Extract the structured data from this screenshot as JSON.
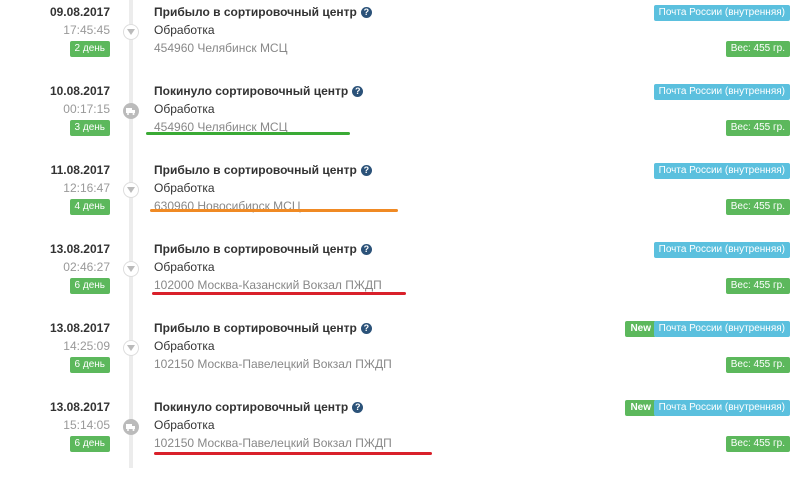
{
  "entries": [
    {
      "date": "09.08.2017",
      "time": "17:45:45",
      "days": "2 день",
      "status": "Прибыло в сортировочный центр",
      "operation": "Обработка",
      "location": "454960 Челябинск МСЦ",
      "carrier": "Почта России (внутренняя)",
      "weight": "Вес: 455 гр.",
      "marker": "arrow-down-icon",
      "new": ""
    },
    {
      "date": "10.08.2017",
      "time": "00:17:15",
      "days": "3 день",
      "status": "Покинуло сортировочный центр",
      "operation": "Обработка",
      "location": "454960 Челябинск МСЦ",
      "carrier": "Почта России (внутренняя)",
      "weight": "Вес: 455 гр.",
      "marker": "truck-icon",
      "new": "",
      "highlight_color": "#3aaa35"
    },
    {
      "date": "11.08.2017",
      "time": "12:16:47",
      "days": "4 день",
      "status": "Прибыло в сортировочный центр",
      "operation": "Обработка",
      "location": "630960 Новосибирск МСЦ",
      "carrier": "Почта России (внутренняя)",
      "weight": "Вес: 455 гр.",
      "marker": "arrow-down-icon",
      "new": "",
      "highlight_color": "#f08a24"
    },
    {
      "date": "13.08.2017",
      "time": "02:46:27",
      "days": "6 день",
      "status": "Прибыло в сортировочный центр",
      "operation": "Обработка",
      "location": "102000 Москва-Казанский Вокзал ПЖДП",
      "carrier": "Почта России (внутренняя)",
      "weight": "Вес: 455 гр.",
      "marker": "arrow-down-icon",
      "new": "",
      "highlight_color": "#d9202a"
    },
    {
      "date": "13.08.2017",
      "time": "14:25:09",
      "days": "6 день",
      "status": "Прибыло в сортировочный центр",
      "operation": "Обработка",
      "location": "102150 Москва-Павелецкий Вокзал ПЖДП",
      "carrier": "Почта России (внутренняя)",
      "weight": "Вес: 455 гр.",
      "marker": "arrow-down-icon",
      "new": "New"
    },
    {
      "date": "13.08.2017",
      "time": "15:14:05",
      "days": "6 день",
      "status": "Покинуло сортировочный центр",
      "operation": "Обработка",
      "location": "102150 Москва-Павелецкий Вокзал ПЖДП",
      "carrier": "Почта России (внутренняя)",
      "weight": "Вес: 455 гр.",
      "marker": "truck-icon",
      "new": "New",
      "highlight_color": "#d9202a"
    }
  ],
  "help_icon_glyph": "?"
}
